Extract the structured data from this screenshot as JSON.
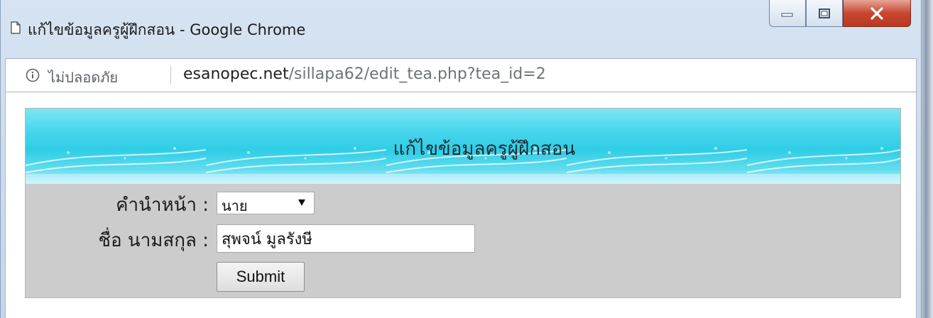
{
  "window": {
    "title": "แก้ไขข้อมูลครูผู้ฝึกสอน - Google Chrome"
  },
  "address_bar": {
    "security_label": "ไม่ปลอดภัย",
    "url_host": "esanopec.net",
    "url_path": "/sillapa62/edit_tea.php?tea_id=2"
  },
  "form": {
    "heading": "แก้ไขข้อมูลครูผู้ฝึกสอน",
    "prefix_label": "คำนำหน้า :",
    "prefix_value": "นาย",
    "name_label": "ชื่อ นามสกุล :",
    "name_value": "สุพจน์ มูลรังษี",
    "submit_label": "Submit"
  },
  "colors": {
    "banner": "#2fcde6",
    "form_background": "#cccccc",
    "close_button": "#c9452f"
  },
  "icons": [
    "page-icon",
    "minimize-icon",
    "maximize-icon",
    "close-icon",
    "info-icon",
    "dropdown-arrow-icon"
  ]
}
